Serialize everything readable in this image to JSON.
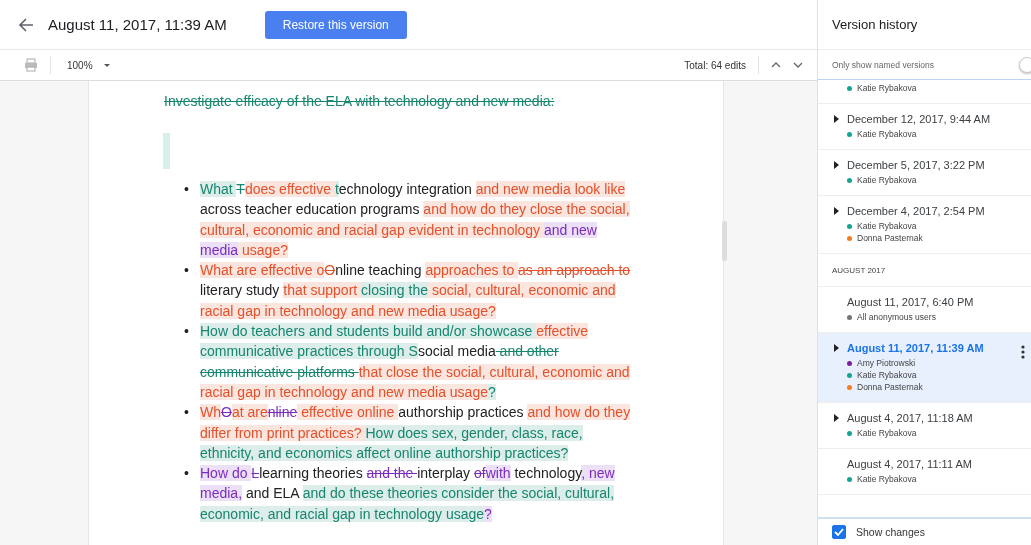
{
  "header": {
    "title": "August 11, 2017, 11:39 AM",
    "restore_button": "Restore this version"
  },
  "toolbar": {
    "zoom": "100%",
    "total_edits": "Total: 64 edits"
  },
  "document": {
    "heading": {
      "text": "Investigate efficacy of the ELA with technology and new media:",
      "color": "#16866f",
      "deleted": true
    },
    "bullet_marker": "•",
    "bullets": [
      [
        {
          "text": "What ",
          "color": "#16866f",
          "deleted": false
        },
        {
          "text": "T",
          "color": "#16866f",
          "deleted": true
        },
        {
          "text": "does effective ",
          "color": "#e4502a",
          "deleted": false
        },
        {
          "text": "t",
          "color": "#16866f",
          "deleted": false
        },
        {
          "text": "echnology integration ",
          "color": "#202124",
          "deleted": false
        },
        {
          "text": "and new media look like",
          "color": "#e4502a",
          "deleted": false
        },
        {
          "text": " across teacher education programs ",
          "color": "#202124",
          "deleted": false
        },
        {
          "text": "and how do they close the social, cultural, economic and racial gap evident in technology ",
          "color": "#e4502a",
          "deleted": false
        },
        {
          "text": "and new media",
          "color": "#7b2cbf",
          "deleted": false
        },
        {
          "text": " usage?",
          "color": "#e4502a",
          "deleted": false
        }
      ],
      [
        {
          "text": "What are effective o",
          "color": "#e4502a",
          "deleted": false
        },
        {
          "text": "O",
          "color": "#e4502a",
          "deleted": true
        },
        {
          "text": "nline teaching ",
          "color": "#202124",
          "deleted": false
        },
        {
          "text": "approaches to ",
          "color": "#e4502a",
          "deleted": false
        },
        {
          "text": "as an approach to ",
          "color": "#e4502a",
          "deleted": true
        },
        {
          "text": "literary study ",
          "color": "#202124",
          "deleted": false
        },
        {
          "text": "that support ",
          "color": "#e4502a",
          "deleted": false
        },
        {
          "text": "closing the",
          "color": "#16866f",
          "deleted": false
        },
        {
          "text": " social, cultural, economic and racial gap in technology and new media usage?",
          "color": "#e4502a",
          "deleted": false
        }
      ],
      [
        {
          "text": "How do teachers and students build and/or showcase ",
          "color": "#16866f",
          "deleted": false
        },
        {
          "text": "effective",
          "color": "#e4502a",
          "deleted": false
        },
        {
          "text": " communicative practices through S",
          "color": "#16866f",
          "deleted": false
        },
        {
          "text": "social media",
          "color": "#202124",
          "deleted": false
        },
        {
          "text": " and other communicative platforms ",
          "color": "#16866f",
          "deleted": true
        },
        {
          "text": " that close the social, cultural, economic and racial gap in technology and new media usage",
          "color": "#e4502a",
          "deleted": false
        },
        {
          "text": "?",
          "color": "#16866f",
          "deleted": false
        }
      ],
      [
        {
          "text": "Wh",
          "color": "#e4502a",
          "deleted": false
        },
        {
          "text": "O",
          "color": "#7b2cbf",
          "deleted": true
        },
        {
          "text": "at are",
          "color": "#e4502a",
          "deleted": false
        },
        {
          "text": "nline",
          "color": "#7b2cbf",
          "deleted": true
        },
        {
          "text": " effective online ",
          "color": "#e4502a",
          "deleted": false
        },
        {
          "text": "authorship practices ",
          "color": "#202124",
          "deleted": false
        },
        {
          "text": "and how do they differ from print practices? ",
          "color": "#e4502a",
          "deleted": false
        },
        {
          "text": "How does sex, gender, class, race, ethnicity, and economics affect online authorship practices?",
          "color": "#16866f",
          "deleted": false
        }
      ],
      [
        {
          "text": "How do ",
          "color": "#7b2cbf",
          "deleted": false
        },
        {
          "text": "L",
          "color": "#7b2cbf",
          "deleted": true
        },
        {
          "text": "learning theories ",
          "color": "#202124",
          "deleted": false
        },
        {
          "text": "and the ",
          "color": "#7b2cbf",
          "deleted": true
        },
        {
          "text": "interplay ",
          "color": "#202124",
          "deleted": false
        },
        {
          "text": "of",
          "color": "#7b2cbf",
          "deleted": true
        },
        {
          "text": "with",
          "color": "#7b2cbf",
          "deleted": false
        },
        {
          "text": " technology",
          "color": "#202124",
          "deleted": false
        },
        {
          "text": ", new media,",
          "color": "#7b2cbf",
          "deleted": false
        },
        {
          "text": " and ELA ",
          "color": "#202124",
          "deleted": false
        },
        {
          "text": "and do these theories consider the social, cultural, economic, and racial gap in technology usage",
          "color": "#16866f",
          "deleted": false
        },
        {
          "text": "?",
          "color": "#7b2cbf",
          "deleted": false
        }
      ]
    ]
  },
  "sidebar": {
    "title": "Version history",
    "named_only": {
      "label": "Only show named versions",
      "on": false
    },
    "items": [
      {
        "kind": "version",
        "selected": false,
        "authors": [
          {
            "name": "Katie Rybakova",
            "color": "#12a594"
          }
        ]
      },
      {
        "kind": "version",
        "title": "December 12, 2017, 9:44 AM",
        "expandable": true,
        "selected": false,
        "authors": [
          {
            "name": "Katie Rybakova",
            "color": "#12a594"
          }
        ]
      },
      {
        "kind": "version",
        "title": "December 5, 2017, 3:22 PM",
        "expandable": true,
        "selected": false,
        "authors": [
          {
            "name": "Katie Rybakova",
            "color": "#12a594"
          }
        ]
      },
      {
        "kind": "version",
        "title": "December 4, 2017, 2:54 PM",
        "expandable": true,
        "selected": false,
        "authors": [
          {
            "name": "Katie Rybakova",
            "color": "#12a594"
          },
          {
            "name": "Donna Pasternak",
            "color": "#f57c1f"
          }
        ]
      },
      {
        "kind": "section",
        "title": "AUGUST 2017"
      },
      {
        "kind": "version",
        "title": "August 11, 2017, 6:40 PM",
        "expandable": false,
        "selected": false,
        "authors": [
          {
            "name": "All anonymous users",
            "color": "#757575"
          }
        ]
      },
      {
        "kind": "version",
        "title": "August 11, 2017, 11:39 AM",
        "expandable": true,
        "selected": true,
        "authors": [
          {
            "name": "Amy Piotrowski",
            "color": "#7b1fa2"
          },
          {
            "name": "Katie Rybakova",
            "color": "#12a594"
          },
          {
            "name": "Donna Pasternak",
            "color": "#f57c1f"
          }
        ]
      },
      {
        "kind": "version",
        "title": "August 4, 2017, 11:18 AM",
        "expandable": true,
        "selected": false,
        "authors": [
          {
            "name": "Katie Rybakova",
            "color": "#12a594"
          }
        ]
      },
      {
        "kind": "version",
        "title": "August 4, 2017, 11:11 AM",
        "expandable": false,
        "selected": false,
        "authors": [
          {
            "name": "Katie Rybakova",
            "color": "#12a594"
          }
        ]
      }
    ],
    "show_changes": {
      "label": "Show changes",
      "checked": true
    }
  }
}
